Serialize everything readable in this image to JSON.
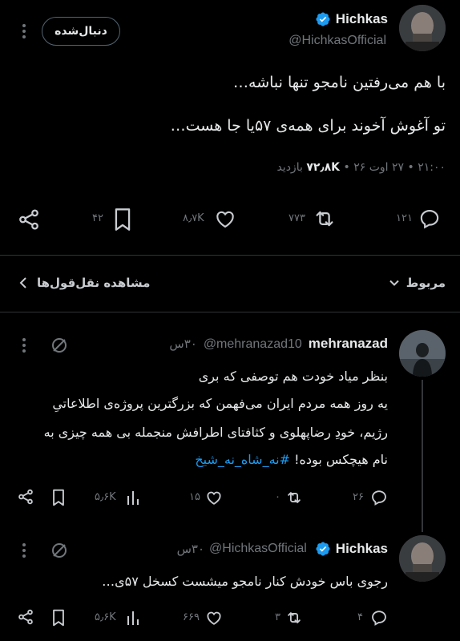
{
  "main_tweet": {
    "author_name": "Hichkas",
    "author_handle": "@HichkasOfficial",
    "follow_label": "دنبال‌شده",
    "line1": "با هم می‌رفتین نامجو تنها نباشه…",
    "line2": "تو آغوش آخوند برای همه‌ی ۵۷یا جا هست…",
    "meta_time": "۲۱:۰۰ • ۲۷ اوت ۲۶ •",
    "meta_views_number": "۷۲٫۸K",
    "meta_views_label": "بازدید",
    "actions": {
      "reply_count": "۱۲۱",
      "retweet_count": "۷۷۳",
      "like_count": "۸٫۷K",
      "bookmark_count": "۴۲"
    }
  },
  "sort": {
    "label": "مربوط",
    "quotes_label": "مشاهده نقل‌قول‌ها"
  },
  "reply1": {
    "author_name": "mehranazad",
    "author_handle": "@mehranazad10",
    "time": "۳۰س",
    "line1": "بنظر میاد خودت هم توصفی که بری",
    "line2": "یه روز همه مردم ایران  می‌فهمن که بزرگترین پروژه‌ی اطلاعاتیِ",
    "line3": "رژیم، خودِ رضاپهلوی و کثافتای اطرافش منجمله بی همه چیزی به",
    "line4_text": "نام هیچکس بوده!",
    "line4_hashtag": "#نه_شاه_نه_شیخ",
    "actions": {
      "reply_count": "۲۶",
      "retweet_count": "۰",
      "like_count": "۱۵",
      "views_count": "۵٫۶K"
    }
  },
  "reply2": {
    "author_name": "Hichkas",
    "author_handle": "@HichkasOfficial",
    "time": "۳۰س",
    "line1": "رجوی باس خودش کنار نامجو میشست کسخل ۵۷ی…",
    "actions": {
      "reply_count": "۴",
      "retweet_count": "۳",
      "like_count": "۶۶۹",
      "views_count": "۵٫۶K"
    }
  },
  "colors": {
    "background": "#000000",
    "text": "#e7e9ea",
    "muted": "#71767b",
    "accent": "#1d9bf0"
  }
}
